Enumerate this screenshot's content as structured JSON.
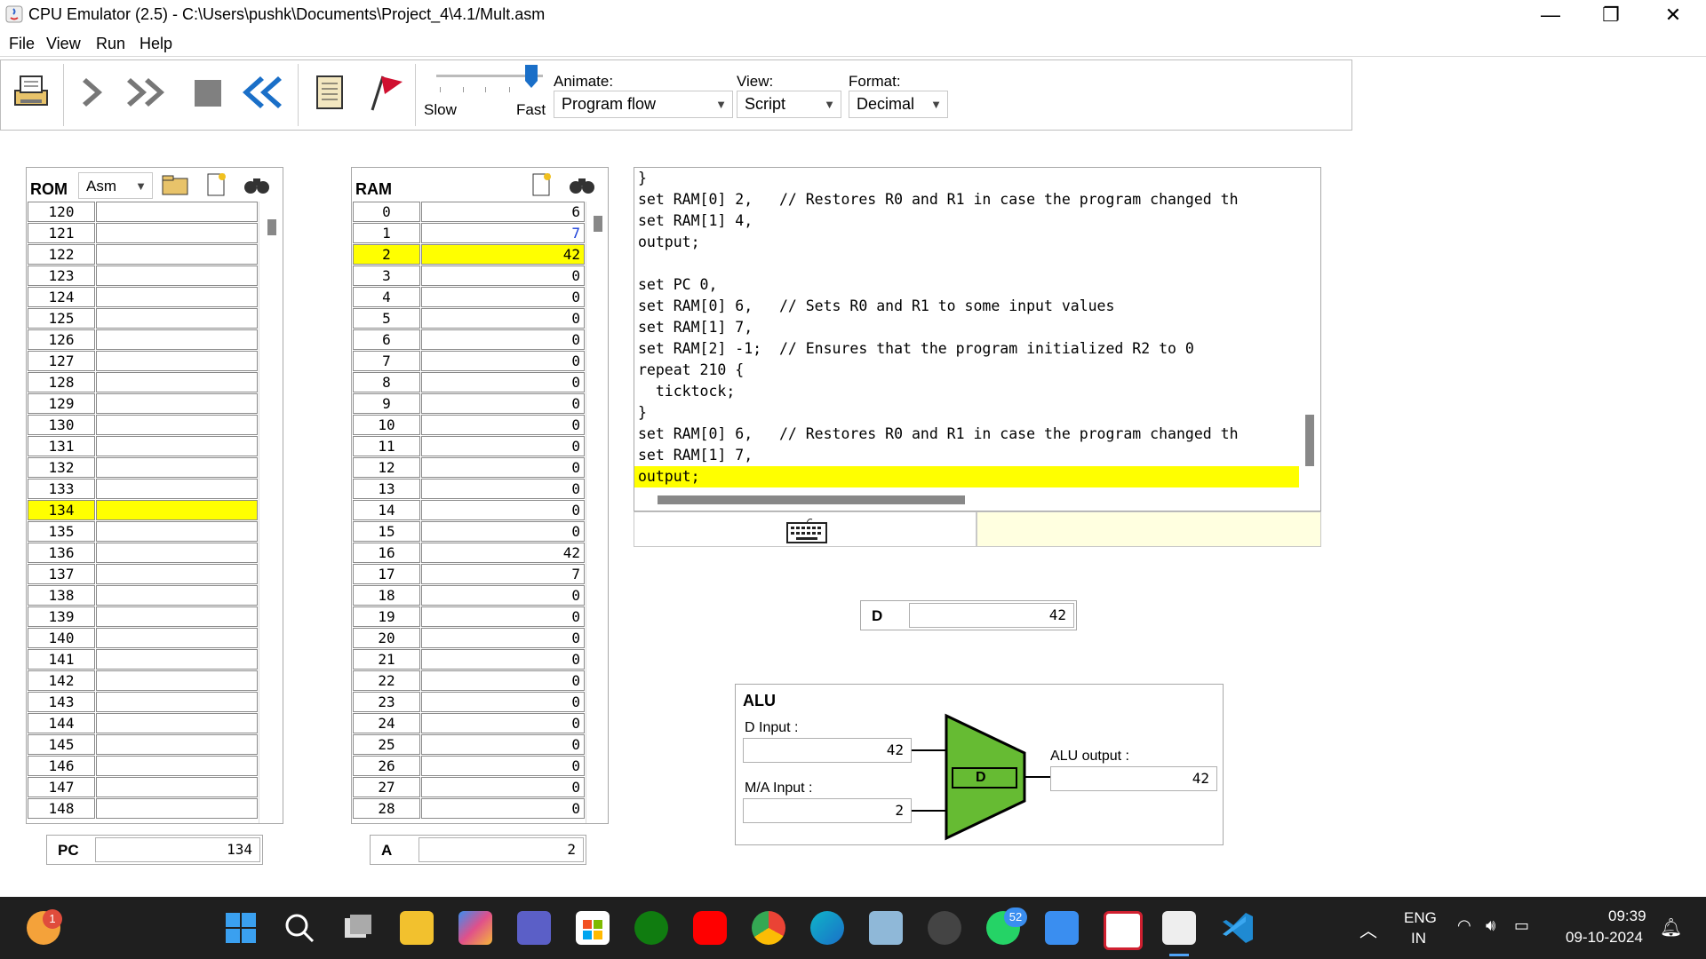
{
  "window": {
    "title": "CPU Emulator (2.5) - C:\\Users\\pushk\\Documents\\Project_4\\4.1/Mult.asm"
  },
  "menu": [
    "File",
    "View",
    "Run",
    "Help"
  ],
  "toolbar": {
    "speed": {
      "slow": "Slow",
      "fast": "Fast"
    },
    "animate": {
      "label": "Animate:",
      "value": "Program flow"
    },
    "view": {
      "label": "View:",
      "value": "Script"
    },
    "format": {
      "label": "Format:",
      "value": "Decimal"
    }
  },
  "rom": {
    "title": "ROM",
    "mode": "Asm",
    "rows": [
      "120",
      "121",
      "122",
      "123",
      "124",
      "125",
      "126",
      "127",
      "128",
      "129",
      "130",
      "131",
      "132",
      "133",
      "134",
      "135",
      "136",
      "137",
      "138",
      "139",
      "140",
      "141",
      "142",
      "143",
      "144",
      "145",
      "146",
      "147",
      "148"
    ],
    "highlight": "134"
  },
  "ram": {
    "title": "RAM",
    "rows": [
      {
        "i": "0",
        "v": "6"
      },
      {
        "i": "1",
        "v": "7"
      },
      {
        "i": "2",
        "v": "42"
      },
      {
        "i": "3",
        "v": "0"
      },
      {
        "i": "4",
        "v": "0"
      },
      {
        "i": "5",
        "v": "0"
      },
      {
        "i": "6",
        "v": "0"
      },
      {
        "i": "7",
        "v": "0"
      },
      {
        "i": "8",
        "v": "0"
      },
      {
        "i": "9",
        "v": "0"
      },
      {
        "i": "10",
        "v": "0"
      },
      {
        "i": "11",
        "v": "0"
      },
      {
        "i": "12",
        "v": "0"
      },
      {
        "i": "13",
        "v": "0"
      },
      {
        "i": "14",
        "v": "0"
      },
      {
        "i": "15",
        "v": "0"
      },
      {
        "i": "16",
        "v": "42"
      },
      {
        "i": "17",
        "v": "7"
      },
      {
        "i": "18",
        "v": "0"
      },
      {
        "i": "19",
        "v": "0"
      },
      {
        "i": "20",
        "v": "0"
      },
      {
        "i": "21",
        "v": "0"
      },
      {
        "i": "22",
        "v": "0"
      },
      {
        "i": "23",
        "v": "0"
      },
      {
        "i": "24",
        "v": "0"
      },
      {
        "i": "25",
        "v": "0"
      },
      {
        "i": "26",
        "v": "0"
      },
      {
        "i": "27",
        "v": "0"
      },
      {
        "i": "28",
        "v": "0"
      }
    ],
    "highlight": "2",
    "blue_value": "1"
  },
  "script": {
    "lines": [
      "}",
      "set RAM[0] 2,   // Restores R0 and R1 in case the program changed th",
      "set RAM[1] 4,",
      "output;",
      "",
      "set PC 0,",
      "set RAM[0] 6,   // Sets R0 and R1 to some input values",
      "set RAM[1] 7,",
      "set RAM[2] -1;  // Ensures that the program initialized R2 to 0",
      "repeat 210 {",
      "  ticktock;",
      "}",
      "set RAM[0] 6,   // Restores R0 and R1 in case the program changed th",
      "set RAM[1] 7,",
      "output;"
    ],
    "highlight_line": 14
  },
  "registers": {
    "pc": {
      "label": "PC",
      "value": "134"
    },
    "a": {
      "label": "A",
      "value": "2"
    },
    "d": {
      "label": "D",
      "value": "42"
    }
  },
  "alu": {
    "title": "ALU",
    "d_input_label": "D Input :",
    "d_input": "42",
    "ma_input_label": "M/A Input :",
    "ma_input": "2",
    "output_label": "ALU output :",
    "output": "42",
    "op": "D"
  },
  "taskbar": {
    "lang1": "ENG",
    "lang2": "IN",
    "time": "09:39",
    "date": "09-10-2024",
    "whatsapp_badge": "52",
    "notif_badge": "1"
  },
  "colors": {
    "highlight": "#ffff00",
    "alu_green": "#66bb33",
    "taskbar": "#1f1f1f"
  }
}
